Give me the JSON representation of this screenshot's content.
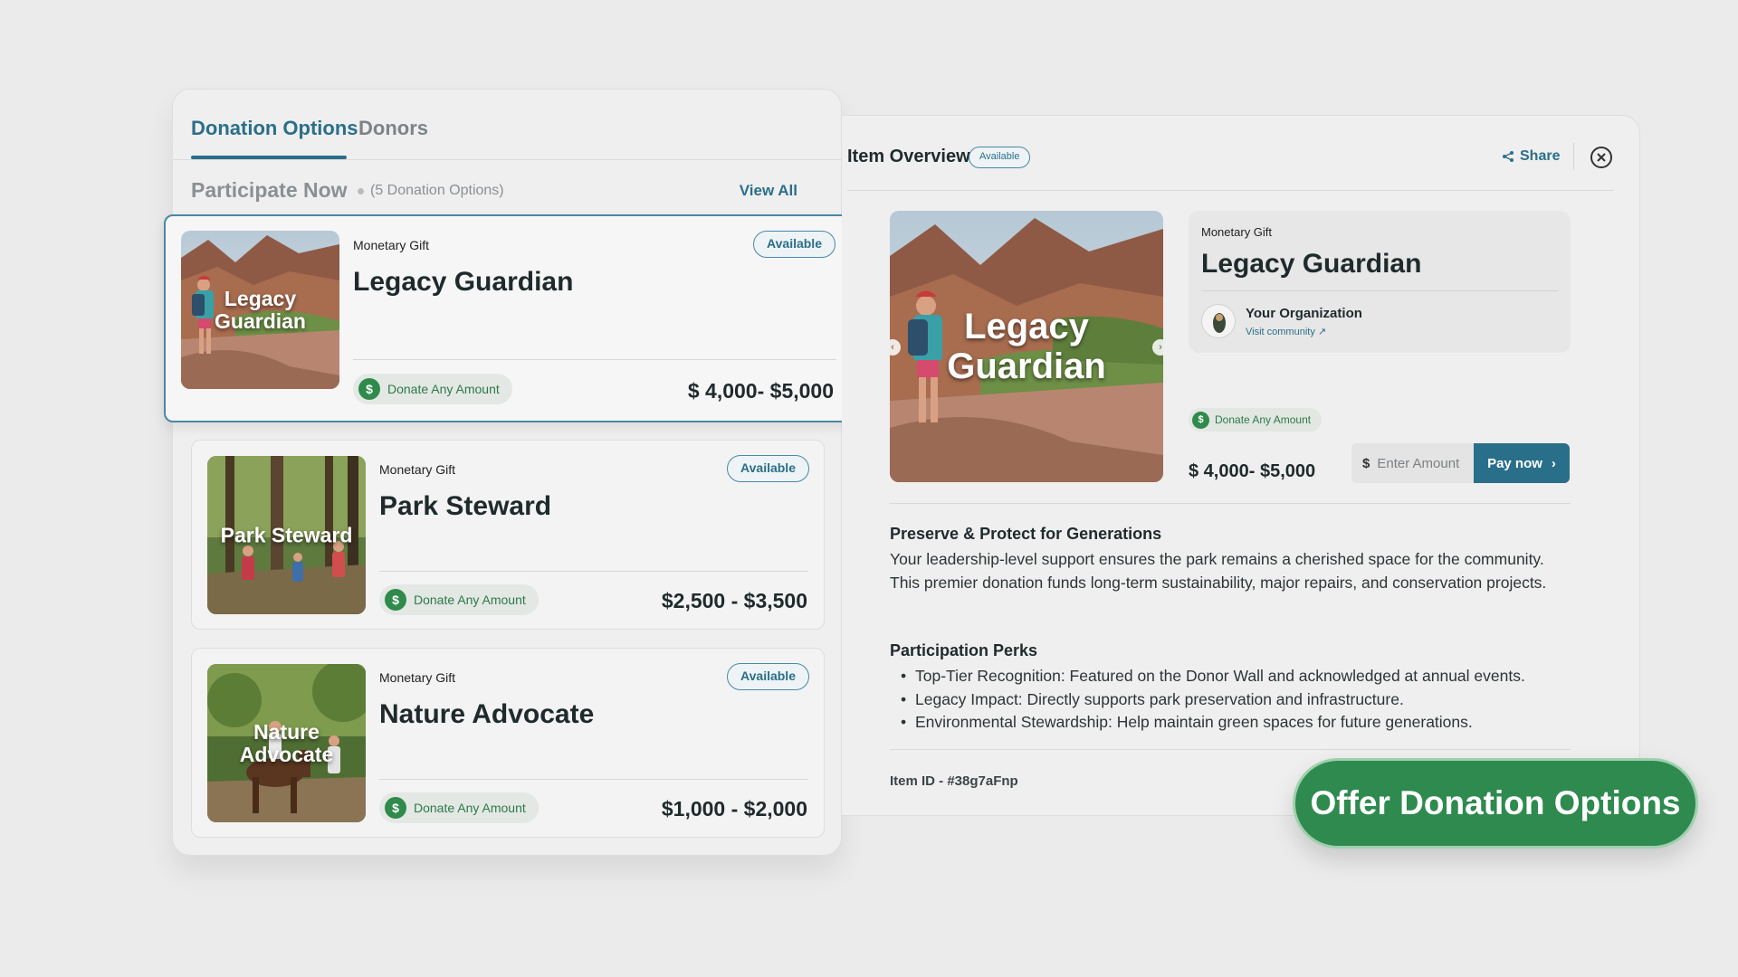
{
  "tabs": {
    "donation_options": "Donation Options",
    "donors": "Donors"
  },
  "participate": {
    "title": "Participate Now",
    "count": "(5 Donation Options)",
    "view_all": "View All"
  },
  "donation_cards": [
    {
      "image_label": "Legacy Guardian",
      "kind": "Monetary Gift",
      "name": "Legacy Guardian",
      "status": "Available",
      "pill": "Donate Any Amount",
      "price": "$ 4,000- $5,000"
    },
    {
      "image_label": "Park Steward",
      "kind": "Monetary Gift",
      "name": "Park Steward",
      "status": "Available",
      "pill": "Donate Any Amount",
      "price": "$2,500 - $3,500"
    },
    {
      "image_label": "Nature Advocate",
      "kind": "Monetary Gift",
      "name": "Nature Advocate",
      "status": "Available",
      "pill": "Donate Any Amount",
      "price": "$1,000 - $2,000"
    }
  ],
  "overview": {
    "title": "Item Overview",
    "status": "Available",
    "share": "Share",
    "hero_label": "Legacy Guardian",
    "kind": "Monetary Gift",
    "name": "Legacy Guardian",
    "org_name": "Your Organization",
    "org_link": "Visit community ↗",
    "pill": "Donate Any Amount",
    "price": "$ 4,000- $5,000",
    "currency_symbol": "$",
    "amount_placeholder": "Enter Amount",
    "pay_label": "Pay now",
    "section1_title": "Preserve & Protect for Generations",
    "section1_body": "Your leadership-level support ensures the park remains a cherished space for the community. This premier donation funds long-term sustainability, major repairs, and conservation projects.",
    "perks_title": "Participation Perks",
    "perks": [
      "Top-Tier Recognition: Featured on the Donor Wall and acknowledged at annual events.",
      "Legacy Impact: Directly supports park preservation and infrastructure.",
      "Environmental Stewardship: Help maintain green spaces for future generations."
    ],
    "item_id": "Item ID - #38g7aFnp"
  },
  "cta": {
    "label": "Offer Donation Options"
  },
  "colors": {
    "accent": "#2a6f8a",
    "green": "#2e8a4e",
    "background": "#ebebec"
  }
}
